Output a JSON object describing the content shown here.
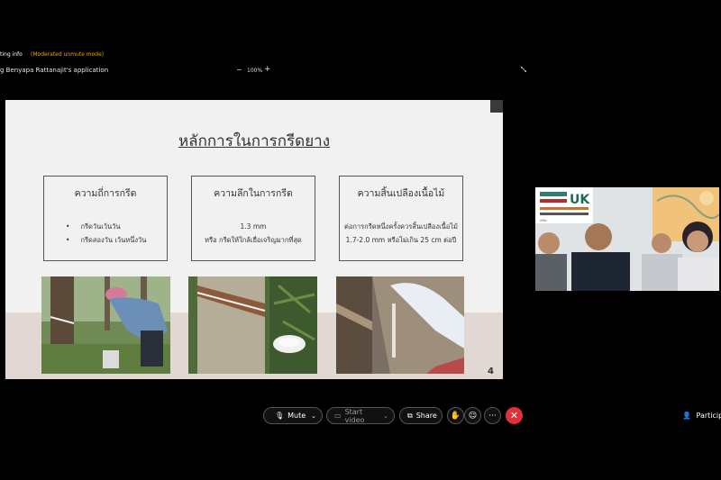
{
  "topbar": {
    "meeting_info": "ting info",
    "unmute_mode": "(Moderated unmute mode)",
    "share_title": "g Benyapa Rattanajit's application",
    "zoom_minus": "−",
    "zoom_level": "100%",
    "zoom_plus": "+"
  },
  "slide": {
    "title": "หลักการในการกรีดยาง",
    "boxes": [
      {
        "heading": "ความถี่การกรีด",
        "bullets": [
          "กรีดวันเว้นวัน",
          "กรีดสองวัน เว้นหนึ่งวัน"
        ]
      },
      {
        "heading": "ความลึกในการกรีด",
        "lines": [
          "1.3 mm",
          "หรือ กรีดให้ใกล้เยื่อเจริญมากที่สุด"
        ]
      },
      {
        "heading": "ความสิ้นเปลืองเนื้อไม้",
        "lines": [
          "ต่อการกรีดหนึ่งครั้งควรสิ้นเปลืองเนื้อไม้",
          "1.7-2.0 mm หรือไม่เกิน 25 cm ต่อปี"
        ]
      }
    ],
    "page_number": "4"
  },
  "video": {
    "logo_text": "UK",
    "banner_line": "บริษัท"
  },
  "toolbar": {
    "mute_label": "Mute",
    "start_video_label": "Start video",
    "share_label": "Share",
    "more_label": "···",
    "participants_label": "Participa"
  }
}
